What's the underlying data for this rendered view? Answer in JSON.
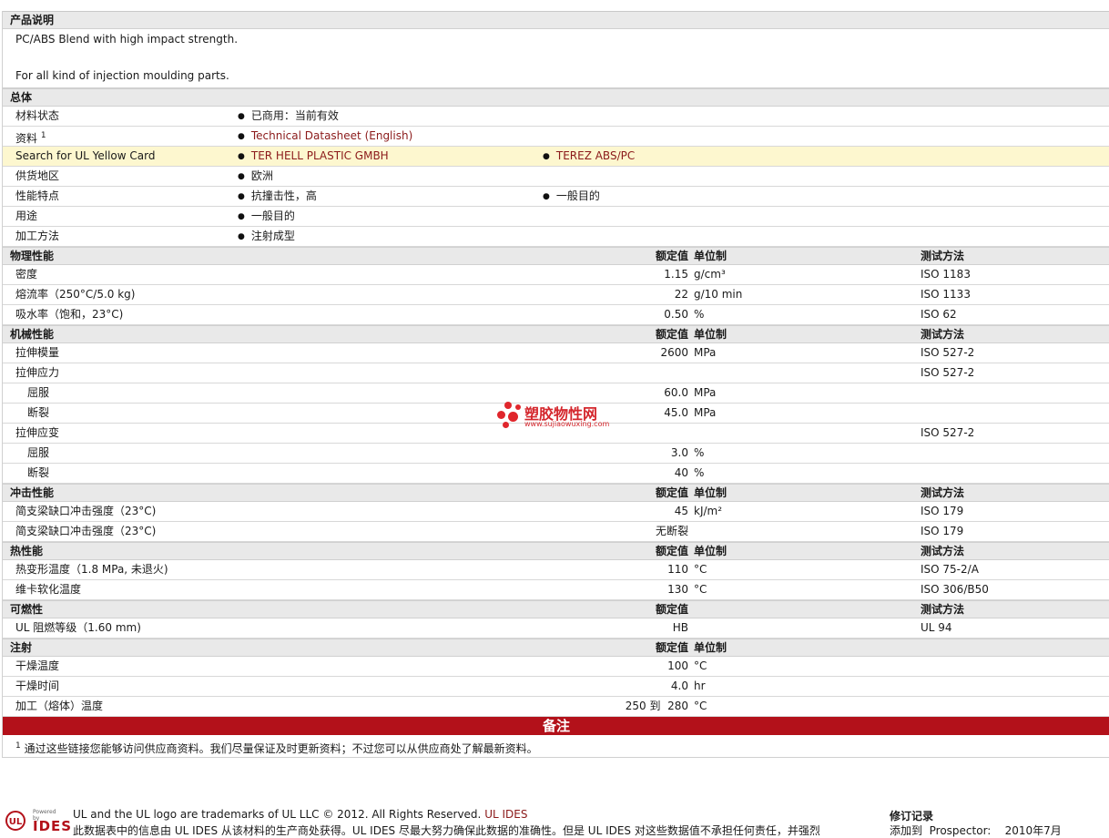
{
  "sections": {
    "description": {
      "title": "产品说明",
      "line1": "PC/ABS Blend with high impact strength.",
      "line2": "For all kind of injection moulding parts."
    },
    "general": {
      "title": "总体",
      "material_status_label": "材料状态",
      "material_status_value": "已商用：当前有效",
      "documents_label": "资料",
      "documents_sup": "1",
      "documents_link": "Technical Datasheet (English)",
      "yellow_card_label": "Search for UL Yellow Card",
      "yellow_card_link1": "TER HELL PLASTIC GMBH",
      "yellow_card_link2": "TEREZ ABS/PC",
      "availability_label": "供货地区",
      "availability_value": "欧洲",
      "features_label": "性能特点",
      "features_value1": "抗撞击性，高",
      "features_value2": "一般目的",
      "uses_label": "用途",
      "uses_value": "一般目的",
      "processing_label": "加工方法",
      "processing_value": "注射成型"
    },
    "col_headers": {
      "nominal": "额定值",
      "unit": "单位制",
      "method": "测试方法"
    },
    "physical": {
      "title": "物理性能",
      "rows": [
        {
          "label": "密度",
          "value": "1.15",
          "unit": "g/cm³",
          "method": "ISO 1183"
        },
        {
          "label": "熔流率（250°C/5.0 kg)",
          "value": "22",
          "unit": "g/10 min",
          "method": "ISO 1133"
        },
        {
          "label": "吸水率（饱和，23°C)",
          "value": "0.50",
          "unit": "%",
          "method": "ISO 62"
        }
      ]
    },
    "mechanical": {
      "title": "机械性能",
      "modulus": {
        "label": "拉伸模量",
        "value": "2600",
        "unit": "MPa",
        "method": "ISO 527-2"
      },
      "stress": {
        "label": "拉伸应力",
        "method": "ISO 527-2"
      },
      "stress_yield": {
        "label": "屈服",
        "value": "60.0",
        "unit": "MPa"
      },
      "stress_break": {
        "label": "断裂",
        "value": "45.0",
        "unit": "MPa"
      },
      "strain": {
        "label": "拉伸应变",
        "method": "ISO 527-2"
      },
      "strain_yield": {
        "label": "屈服",
        "value": "3.0",
        "unit": "%"
      },
      "strain_break": {
        "label": "断裂",
        "value": "40",
        "unit": "%"
      }
    },
    "impact": {
      "title": "冲击性能",
      "rows": [
        {
          "label": "简支梁缺口冲击强度（23°C)",
          "value": "45",
          "unit": "kJ/m²",
          "method": "ISO 179"
        },
        {
          "label": "简支梁缺口冲击强度（23°C)",
          "value": "无断裂",
          "unit": "",
          "method": "ISO 179"
        }
      ]
    },
    "thermal": {
      "title": "热性能",
      "rows": [
        {
          "label": "热变形温度（1.8 MPa, 未退火)",
          "value": "110",
          "unit": "°C",
          "method": "ISO 75-2/A"
        },
        {
          "label": "维卡软化温度",
          "value": "130",
          "unit": "°C",
          "method": "ISO 306/B50"
        }
      ]
    },
    "flammability": {
      "title": "可燃性",
      "row": {
        "label": "UL 阻燃等级（1.60 mm)",
        "value": "HB",
        "method": "UL 94"
      }
    },
    "injection": {
      "title": "注射",
      "rows": [
        {
          "label": "干燥温度",
          "value": "100",
          "unit": "°C"
        },
        {
          "label": "干燥时间",
          "value": "4.0",
          "unit": "hr"
        },
        {
          "label": "加工（熔体）温度",
          "value": "250 到  280",
          "unit": "°C"
        }
      ]
    },
    "notes": {
      "title": "备注",
      "sup": "1",
      "text": "通过这些链接您能够访问供应商资料。我们尽量保证及时更新资料；不过您可以从供应商处了解最新资料。"
    }
  },
  "watermark": {
    "text": "塑胶物性网",
    "url": "www.sujiaowuxing.com"
  },
  "footer": {
    "logo_ul": "UL",
    "logo_ides": "IDES",
    "logo_powered": "Powered by",
    "trademark": "UL and the UL logo are trademarks of UL LLC © 2012. All Rights Reserved.",
    "trademark_link": "UL IDES",
    "disclaimer": "此数据表中的信息由  UL IDES 从该材料的生产商处获得。UL IDES 尽最大努力确保此数据的准确性。但是  UL IDES 对这些数据值不承担任何责任，并强烈",
    "revision_title": "修订记录",
    "revision_text": "添加到  Prospector:    2010年7月"
  },
  "colors": {
    "accent": "#b3111a",
    "link": "#8b1a1a",
    "yellow_row": "#fdf7cf",
    "header_bg": "#e9e9e9"
  }
}
